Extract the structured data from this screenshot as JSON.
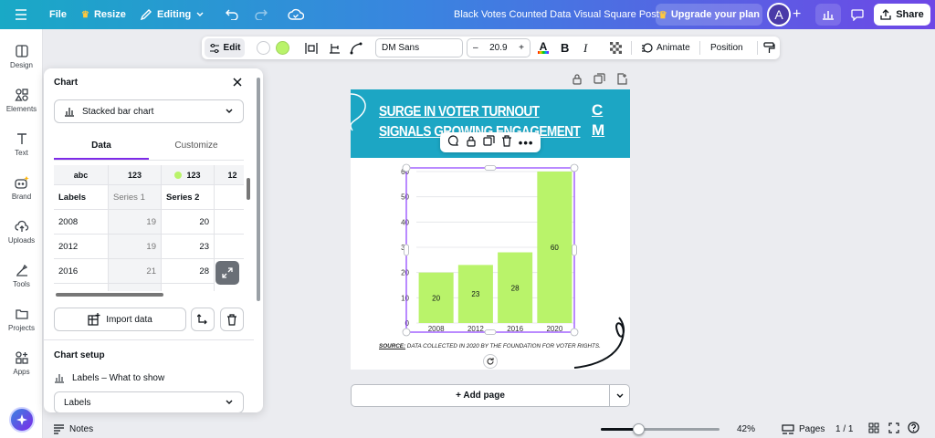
{
  "topbar": {
    "file": "File",
    "resize": "Resize",
    "editing": "Editing",
    "doc_title": "Black Votes Counted Data Visual Square Post",
    "upgrade": "Upgrade your plan",
    "avatar_initial": "A",
    "share": "Share"
  },
  "rail": [
    {
      "label": "Design",
      "icon": "design-icon"
    },
    {
      "label": "Elements",
      "icon": "elements-icon"
    },
    {
      "label": "Text",
      "icon": "text-icon"
    },
    {
      "label": "Brand",
      "icon": "brand-icon"
    },
    {
      "label": "Uploads",
      "icon": "uploads-icon"
    },
    {
      "label": "Tools",
      "icon": "tools-icon"
    },
    {
      "label": "Projects",
      "icon": "projects-icon"
    },
    {
      "label": "Apps",
      "icon": "apps-icon"
    }
  ],
  "panel": {
    "title": "Chart",
    "chart_type": "Stacked bar chart",
    "tabs": [
      "Data",
      "Customize"
    ],
    "col_types": [
      "abc",
      "123",
      "123",
      "12"
    ],
    "headers": [
      "Labels",
      "Series 1",
      "Series 2"
    ],
    "rows": [
      {
        "label": "2008",
        "s1": "19",
        "s2": "20"
      },
      {
        "label": "2012",
        "s1": "19",
        "s2": "23"
      },
      {
        "label": "2016",
        "s1": "21",
        "s2": "28"
      }
    ],
    "import": "Import data",
    "setup_title": "Chart setup",
    "labels_desc": "Labels – What to show",
    "labels_value": "Labels"
  },
  "toolbar": {
    "edit": "Edit",
    "font": "DM Sans",
    "font_size": "20.9",
    "animate": "Animate",
    "position": "Position",
    "accent": "#b9f36a"
  },
  "design": {
    "title_line1": "SURGE IN VOTER TURNOUT",
    "title_line2": "SIGNALS GROWING ENGAGEMENT",
    "logo_line1": "C",
    "logo_line2": "M",
    "source_label": "SOURCE:",
    "source_text": " DATA COLLECTED IN 2020 BY THE FOUNDATION FOR VOTER RIGHTS."
  },
  "chart_data": {
    "type": "bar",
    "categories": [
      "2008",
      "2012",
      "2016",
      "2020"
    ],
    "values": [
      20,
      23,
      28,
      60
    ],
    "ylim": [
      0,
      60
    ],
    "yticks": [
      "0",
      "10",
      "20",
      "30",
      "40",
      "50",
      "60"
    ],
    "bar_color": "#b9f36a"
  },
  "footer": {
    "add_page": "+ Add page",
    "notes": "Notes",
    "zoom": "42%",
    "pages": "Pages",
    "page_count": "1 / 1"
  }
}
